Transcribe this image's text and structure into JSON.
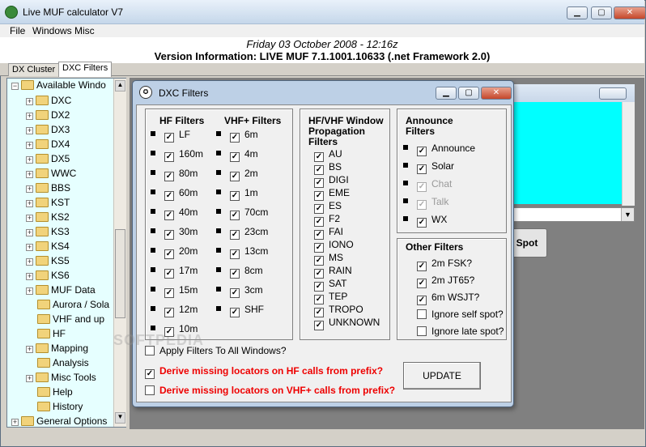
{
  "window": {
    "title": "Live MUF calculator V7"
  },
  "menu": [
    "File",
    "Windows",
    "Misc"
  ],
  "info": {
    "date": "Friday 03 October 2008 - 12:16z",
    "version": "Version Information: LIVE MUF 7.1.1001.10633 (.net Framework 2.0)"
  },
  "tabs": [
    "DX Cluster",
    "DXC Filters"
  ],
  "tree": {
    "root": "Available Windo",
    "items": [
      "DXC",
      "DX2",
      "DX3",
      "DX4",
      "DX5",
      "WWC",
      "BBS",
      "KST",
      "KS2",
      "KS3",
      "KS4",
      "KS5",
      "KS6",
      "MUF Data",
      "Aurora / Sola",
      "VHF and up",
      "HF",
      "Mapping",
      "Analysis",
      "Misc Tools",
      "Help",
      "History"
    ],
    "last": "General Options"
  },
  "spot_button": "l Spot",
  "dialog": {
    "title": "DXC Filters",
    "hf_header": "HF Filters",
    "hf": [
      "LF",
      "160m",
      "80m",
      "60m",
      "40m",
      "30m",
      "20m",
      "17m",
      "15m",
      "12m",
      "10m"
    ],
    "vhf_header": "VHF+ Filters",
    "vhf": [
      "6m",
      "4m",
      "2m",
      "1m",
      "70cm",
      "23cm",
      "13cm",
      "8cm",
      "3cm",
      "SHF"
    ],
    "prop_header": "HF/VHF Window Propagation Filters",
    "prop": [
      "AU",
      "BS",
      "DIGI",
      "EME",
      "ES",
      "F2",
      "FAI",
      "IONO",
      "MS",
      "RAIN",
      "SAT",
      "TEP",
      "TROPO",
      "UNKNOWN"
    ],
    "announce_header": "Announce Filters",
    "announce": [
      {
        "label": "Announce",
        "enabled": true
      },
      {
        "label": "Solar",
        "enabled": true
      },
      {
        "label": "Chat",
        "enabled": false
      },
      {
        "label": "Talk",
        "enabled": false
      },
      {
        "label": "WX",
        "enabled": true
      }
    ],
    "other_header": "Other Filters",
    "other": [
      {
        "label": "2m FSK?",
        "checked": true
      },
      {
        "label": "2m JT65?",
        "checked": true
      },
      {
        "label": "6m WSJT?",
        "checked": true
      },
      {
        "label": "Ignore self spot?",
        "checked": false
      },
      {
        "label": "Ignore late spot?",
        "checked": false
      }
    ],
    "apply_all": "Apply Filters To All Windows?",
    "derive_hf": "Derive missing locators on HF calls from prefix?",
    "derive_vhf": "Derive missing locators on VHF+ calls from prefix?",
    "update": "UPDATE"
  },
  "watermark": "SOFTPEDIA",
  "colors": {
    "cyan": "#00ffff",
    "tree_bg": "#e6ffff",
    "red_text": "#ee0000"
  }
}
